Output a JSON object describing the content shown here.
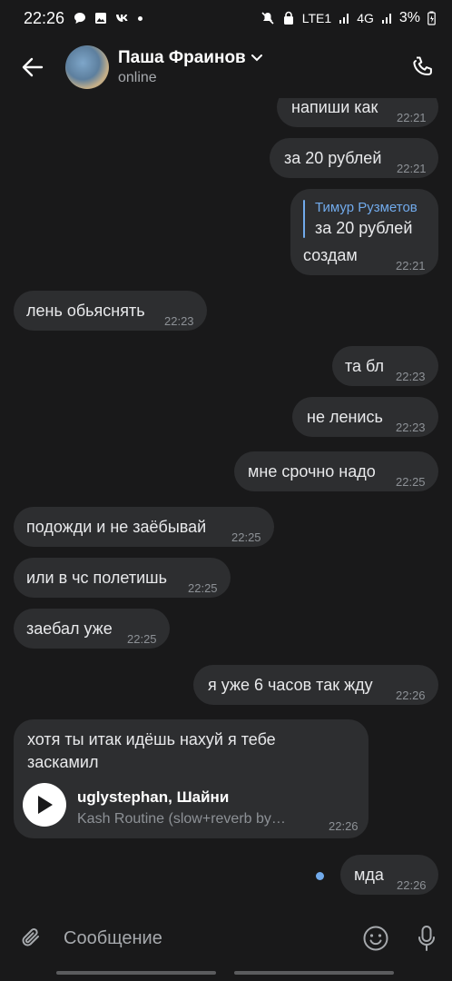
{
  "status_bar": {
    "time": "22:26",
    "network": "LTE1",
    "network2": "4G",
    "battery": "3%"
  },
  "header": {
    "name": "Паша Фраинов",
    "status": "online"
  },
  "messages": [
    {
      "text": "напиши как",
      "time": "22:21",
      "side": "out"
    },
    {
      "text": "за 20 рублей",
      "time": "22:21",
      "side": "out"
    },
    {
      "reply_author": "Тимур Рузметов",
      "reply_text": "за 20 рублей",
      "text": "создам",
      "time": "22:21",
      "side": "out"
    },
    {
      "text": "лень обьяснять",
      "time": "22:23",
      "side": "in"
    },
    {
      "text": "та бл",
      "time": "22:23",
      "side": "out"
    },
    {
      "text": "не ленись",
      "time": "22:23",
      "side": "out"
    },
    {
      "text": "мне срочно надо",
      "time": "22:25",
      "side": "out"
    },
    {
      "text": "подожди и не заёбывай",
      "time": "22:25",
      "side": "in"
    },
    {
      "text": "или в чс полетишь",
      "time": "22:25",
      "side": "in"
    },
    {
      "text": "заебал уже",
      "time": "22:25",
      "side": "in"
    },
    {
      "text": "я уже 6 часов так жду",
      "time": "22:26",
      "side": "out"
    },
    {
      "text_line1": "хотя ты итак идёшь нахуй я тебе",
      "text_line2": "заскамил",
      "audio_title": "uglystephan, Шайни",
      "audio_subtitle": "Kash Routine (slow+reverb by…",
      "time": "22:26",
      "side": "in"
    },
    {
      "text": "мда",
      "time": "22:26",
      "side": "out"
    }
  ],
  "composer": {
    "placeholder": "Сообщение"
  },
  "colors": {
    "background": "#19191a",
    "bubble": "#2d2e30",
    "accent": "#71aaeb"
  }
}
